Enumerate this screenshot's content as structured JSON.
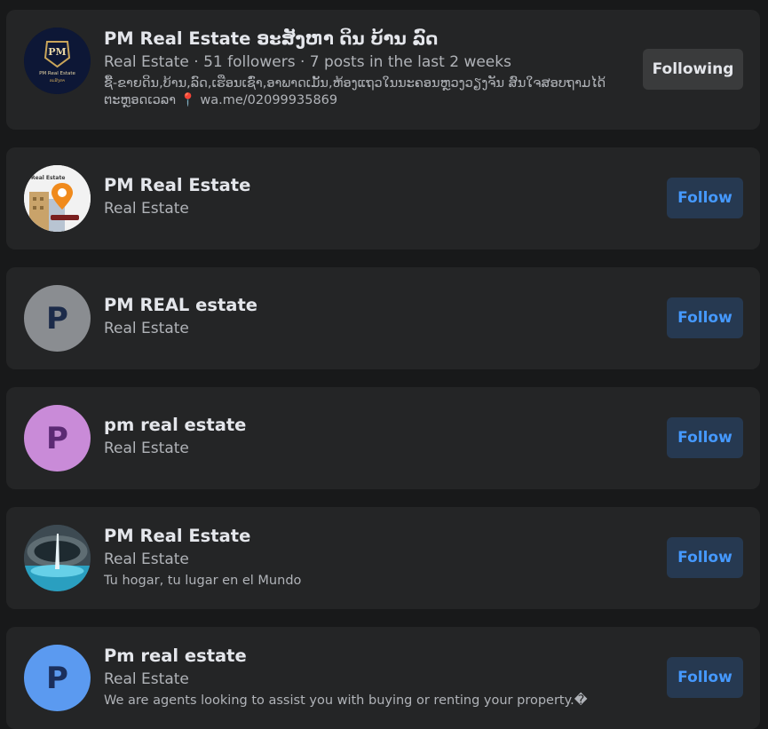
{
  "results": [
    {
      "name": "PM Real Estate ອະສັງຫາ ດິນ ບ້ານ ລົດ",
      "meta": "Real Estate · 51 followers · 7 posts in the last 2 weeks",
      "description": "ຊື້-ຂາຍດິນ,ບ້ານ,ລົດ,ເຮືອນເຊົ່າ,ອາພາດເມັ້ນ,ຫ້ອງແຖວໃນນະຄອນຫຼວງວຽງຈັນ ສົນໃຈສອບຖາມໄດ້ຕະຫຼອດເວລາ",
      "pin_icon": "📍",
      "contact": "wa.me/02099935869",
      "button_label": "Following",
      "avatar_logo_text": "PM",
      "avatar_logo_sub": "PM Real Estate",
      "avatar_logo_sub2": "ອະສັງຫາ"
    },
    {
      "name": "PM Real Estate",
      "meta": "Real Estate",
      "button_label": "Follow",
      "avatar_image_text": "Real Estate"
    },
    {
      "name": "PM REAL estate",
      "meta": "Real Estate",
      "button_label": "Follow",
      "avatar_letter": "P",
      "avatar_bg": "#8a8d91",
      "avatar_fg": "#1c2b4a"
    },
    {
      "name": "pm real estate",
      "meta": "Real Estate",
      "button_label": "Follow",
      "avatar_letter": "P",
      "avatar_bg": "#c98bd8",
      "avatar_fg": "#5b2a73"
    },
    {
      "name": "PM Real Estate",
      "meta": "Real Estate",
      "description": "Tu hogar, tu lugar en el Mundo",
      "button_label": "Follow"
    },
    {
      "name": "Pm real estate",
      "meta": "Real Estate",
      "description": "We are agents looking to assist you with buying or renting your property.�",
      "button_label": "Follow",
      "avatar_letter": "P",
      "avatar_bg": "#5b9af0",
      "avatar_fg": "#1b2f5c"
    }
  ]
}
